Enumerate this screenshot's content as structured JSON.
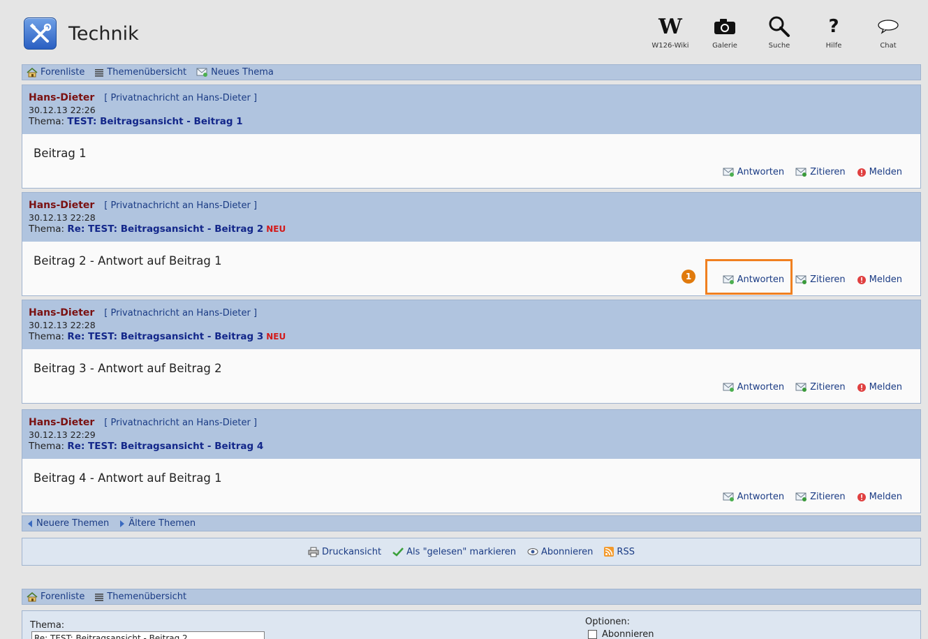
{
  "app": {
    "title": "Technik"
  },
  "topnav": [
    {
      "label": "W126-Wiki",
      "icon": "wiki-w-icon"
    },
    {
      "label": "Galerie",
      "icon": "camera-icon"
    },
    {
      "label": "Suche",
      "icon": "search-icon"
    },
    {
      "label": "Hilfe",
      "icon": "help-icon"
    },
    {
      "label": "Chat",
      "icon": "chat-bubble-icon"
    }
  ],
  "navbar_top": {
    "forenliste": "Forenliste",
    "themen": "Themenübersicht",
    "neues_thema": "Neues Thema"
  },
  "posts": [
    {
      "author": "Hans-Dieter",
      "pm_link": "[ Privatnachricht an Hans-Dieter ]",
      "date": "30.12.13 22:26",
      "topic_prefix": "Thema:",
      "topic": "TEST: Beitragsansicht - Beitrag 1",
      "new_badge": "",
      "body": "Beitrag 1"
    },
    {
      "author": "Hans-Dieter",
      "pm_link": "[ Privatnachricht an Hans-Dieter ]",
      "date": "30.12.13 22:28",
      "topic_prefix": "Thema:",
      "topic": "Re: TEST: Beitragsansicht - Beitrag 2",
      "new_badge": "NEU",
      "body": "Beitrag 2 - Antwort auf Beitrag 1"
    },
    {
      "author": "Hans-Dieter",
      "pm_link": "[ Privatnachricht an Hans-Dieter ]",
      "date": "30.12.13 22:28",
      "topic_prefix": "Thema:",
      "topic": "Re: TEST: Beitragsansicht - Beitrag 3",
      "new_badge": "NEU",
      "body": "Beitrag 3 - Antwort auf Beitrag 2"
    },
    {
      "author": "Hans-Dieter",
      "pm_link": "[ Privatnachricht an Hans-Dieter ]",
      "date": "30.12.13 22:29",
      "topic_prefix": "Thema:",
      "topic": "Re: TEST: Beitragsansicht - Beitrag 4",
      "new_badge": "",
      "body": "Beitrag 4 - Antwort auf Beitrag 1"
    }
  ],
  "actions": {
    "reply": "Antworten",
    "quote": "Zitieren",
    "report": "Melden"
  },
  "annotation": {
    "step": "1"
  },
  "pager": {
    "newer": "Neuere Themen",
    "older": "Ältere Themen"
  },
  "tools": {
    "print": "Druckansicht",
    "mark_read": "Als \"gelesen\" markieren",
    "subscribe": "Abonnieren",
    "rss": "RSS"
  },
  "navbar_bottom": {
    "forenliste": "Forenliste",
    "themen": "Themenübersicht"
  },
  "reply_form": {
    "topic_label": "Thema:",
    "topic_value": "Re: TEST: Beitragsansicht - Beitrag 2",
    "options_label": "Optionen:",
    "subscribe_label": "Abonnieren"
  },
  "colors": {
    "header_bg": "#b0c4df",
    "author": "#7a1111",
    "link": "#1a3b84",
    "new_badge": "#d31a1a",
    "highlight": "#f08020"
  }
}
